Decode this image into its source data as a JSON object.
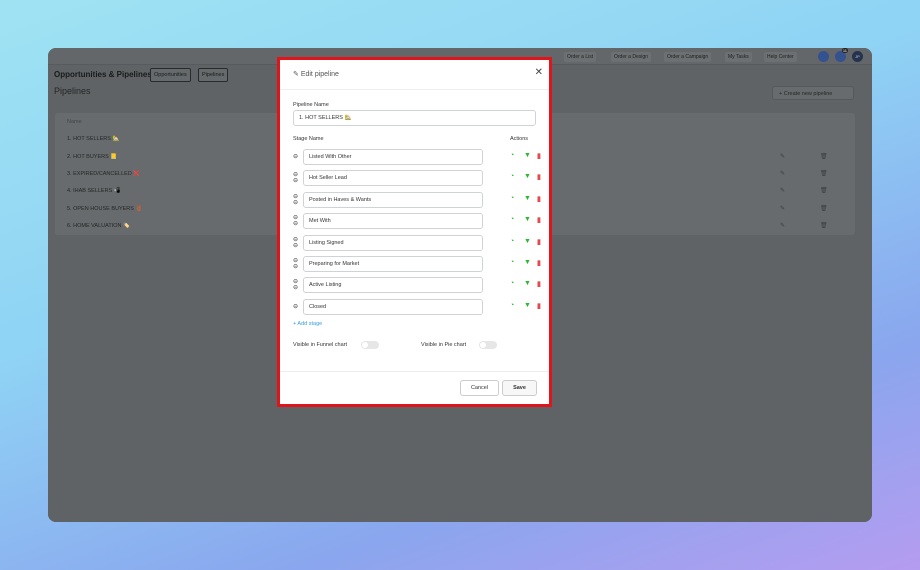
{
  "topbar": {
    "buttons": [
      "Order a List",
      "Order a Design",
      "Order a Campaign",
      "My Tasks",
      "Help Center"
    ],
    "notification_count": "11",
    "avatar": "JP"
  },
  "header": {
    "title": "Opportunities & Pipelines",
    "tabs": [
      "Opportunities",
      "Pipelines"
    ]
  },
  "page": {
    "title": "Pipelines",
    "create_label": "+ Create new pipeline",
    "column_name": "Name",
    "pipelines": [
      "1. HOT SELLERS 🏡",
      "2. HOT BUYERS 📒",
      "3. EXPIRED/CANCELLED ❌",
      "4. IHAB SELLERS 📲",
      "5. OPEN HOUSE BUYERS 🚪",
      "6. HOME VALUATION 🏷️"
    ]
  },
  "modal": {
    "title": "Edit pipeline",
    "pipeline_name_label": "Pipeline Name",
    "pipeline_name": "1. HOT SELLERS 🏡",
    "stage_name_label": "Stage Name",
    "actions_label": "Actions",
    "stages": [
      "Listed With Other",
      "Hot Seller Lead",
      "Posted in Haves & Wants",
      "Met With",
      "Listing Signed",
      "Preparing for Market",
      "Active Listing",
      "Closed"
    ],
    "add_stage": "+ Add stage",
    "funnel_label": "Visible in Funnel chart",
    "pie_label": "Visible in Pie chart",
    "funnel_visible": false,
    "pie_visible": false,
    "cancel": "Cancel",
    "save": "Save"
  },
  "colors": {
    "highlight": "#e1141b",
    "action_green": "#2eb82e",
    "delete_red": "#e5484d",
    "link": "#3a9be0"
  }
}
